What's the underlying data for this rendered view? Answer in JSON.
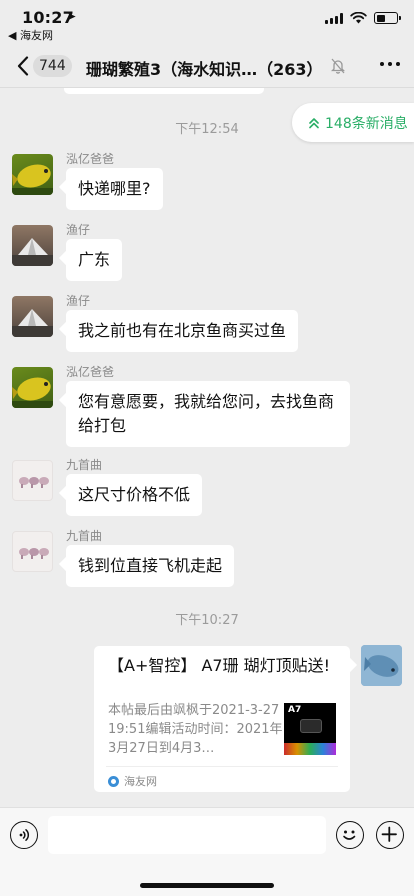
{
  "status_bar": {
    "time": "10:27",
    "back_app": "◀ 海友网",
    "battery_level": 0.45
  },
  "nav": {
    "unread_count": "744",
    "title": "珊瑚繁殖3（海水知识…（263）",
    "more_icon": "more-dots-icon",
    "mute_icon": "bell-muted-icon"
  },
  "chat": {
    "timestamp_1": "下午12:54",
    "new_messages": "148条新消息",
    "messages": [
      {
        "sender": "泓亿爸爸",
        "text": "快递哪里?",
        "avatar": "green-fish-avatar"
      },
      {
        "sender": "渔仔",
        "text": "广东",
        "avatar": "tent-avatar"
      },
      {
        "sender": "渔仔",
        "text": "我之前也有在北京鱼商买过鱼",
        "avatar": "tent-avatar"
      },
      {
        "sender": "泓亿爸爸",
        "text": "您有意愿要，我就给您问，去找鱼商给打包",
        "avatar": "green-fish-avatar"
      },
      {
        "sender": "九首曲",
        "text": "这尺寸价格不低",
        "avatar": "elephant-avatar"
      },
      {
        "sender": "九首曲",
        "text": "钱到位直接飞机走起",
        "avatar": "elephant-avatar"
      }
    ],
    "timestamp_2": "下午10:27",
    "link_card": {
      "title": "【A+智控】 A7珊 瑚灯顶贴送!",
      "description": "本帖最后由飒枫于2021-3-2719:51编辑活动时间：2021年3月27日到4月3…",
      "thumb_label": "A7",
      "source": "海友网"
    }
  },
  "input_bar": {
    "placeholder": ""
  },
  "colors": {
    "accent_green": "#2aae67",
    "background": "#ededed",
    "bubble": "#ffffff"
  }
}
